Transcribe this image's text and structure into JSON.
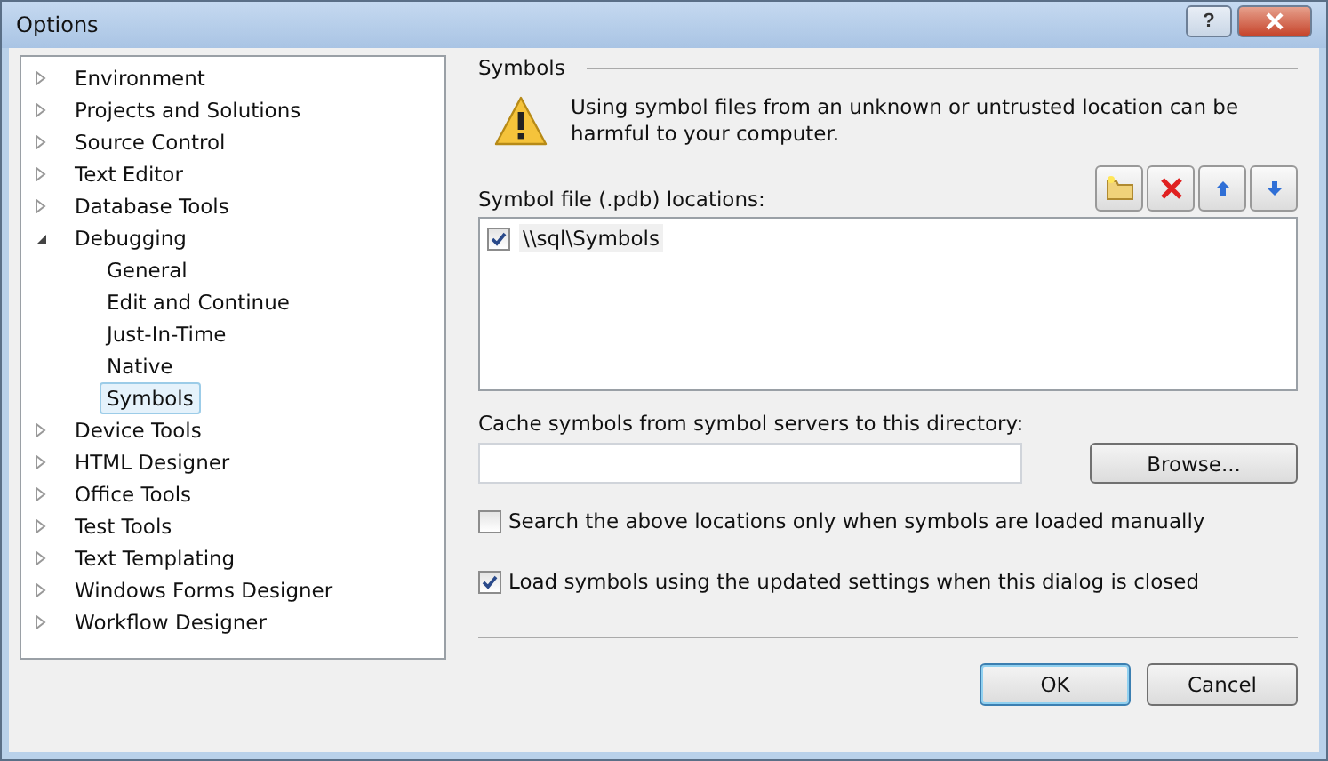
{
  "window": {
    "title": "Options",
    "help": "?"
  },
  "tree": [
    {
      "label": "Environment",
      "expanded": false,
      "selected": false
    },
    {
      "label": "Projects and Solutions",
      "expanded": false,
      "selected": false
    },
    {
      "label": "Source Control",
      "expanded": false,
      "selected": false
    },
    {
      "label": "Text Editor",
      "expanded": false,
      "selected": false
    },
    {
      "label": "Database Tools",
      "expanded": false,
      "selected": false
    },
    {
      "label": "Debugging",
      "expanded": true,
      "selected": false,
      "children": [
        {
          "label": "General",
          "selected": false
        },
        {
          "label": "Edit and Continue",
          "selected": false
        },
        {
          "label": "Just-In-Time",
          "selected": false
        },
        {
          "label": "Native",
          "selected": false
        },
        {
          "label": "Symbols",
          "selected": true
        }
      ]
    },
    {
      "label": "Device Tools",
      "expanded": false,
      "selected": false
    },
    {
      "label": "HTML Designer",
      "expanded": false,
      "selected": false
    },
    {
      "label": "Office Tools",
      "expanded": false,
      "selected": false
    },
    {
      "label": "Test Tools",
      "expanded": false,
      "selected": false
    },
    {
      "label": "Text Templating",
      "expanded": false,
      "selected": false
    },
    {
      "label": "Windows Forms Designer",
      "expanded": false,
      "selected": false
    },
    {
      "label": "Workflow Designer",
      "expanded": false,
      "selected": false
    }
  ],
  "section": {
    "title": "Symbols",
    "warning": "Using symbol files from an unknown or untrusted location can be harmful to your computer.",
    "locations_label": "Symbol file (.pdb) locations:",
    "locations": [
      {
        "path": "\\\\sql\\Symbols",
        "checked": true
      }
    ],
    "cache_label": "Cache symbols from symbol servers to this directory:",
    "browse": "Browse...",
    "options": [
      {
        "label": "Search the above locations only when symbols are loaded manually",
        "checked": false
      },
      {
        "label": "Load symbols using the updated settings when this dialog is closed",
        "checked": true
      }
    ]
  },
  "buttons": [
    {
      "label": "OK",
      "default": true
    },
    {
      "label": "Cancel",
      "default": false
    }
  ]
}
